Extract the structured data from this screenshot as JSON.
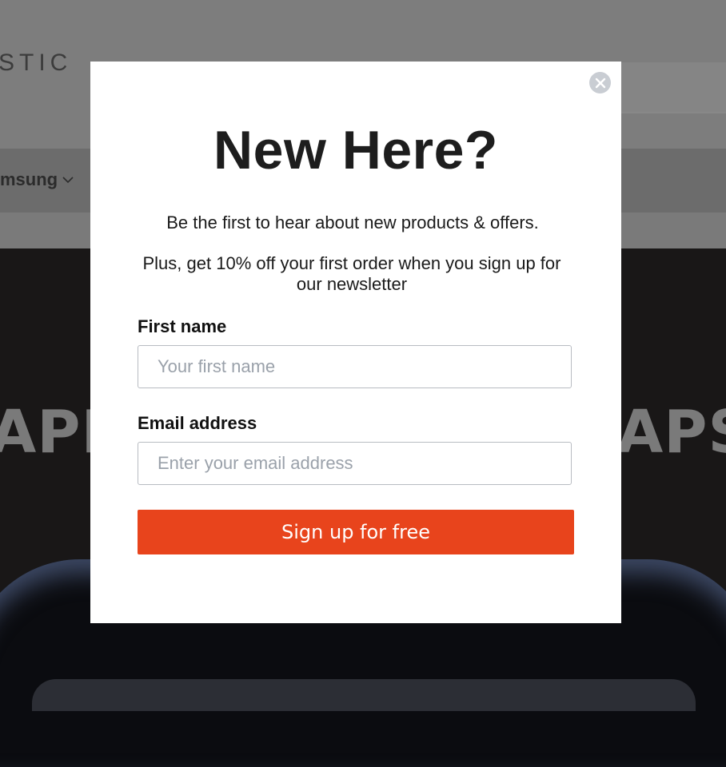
{
  "site": {
    "logo_fragment": "STIC",
    "nav_item": "msung",
    "hero_left_text": "APP",
    "hero_right_text": "APS"
  },
  "modal": {
    "title": "New Here?",
    "subtitle": "Be the first to hear about new products & offers.",
    "offer_text": "Plus, get 10% off your first order when you sign up for our newsletter",
    "first_name_label": "First name",
    "first_name_placeholder": "Your first name",
    "email_label": "Email address",
    "email_placeholder": "Enter your email address",
    "submit_label": "Sign up for free",
    "close_icon": "close-icon"
  },
  "colors": {
    "overlay": "#7b7b7b",
    "submit_bg": "#e8441c",
    "submit_text": "#ffffff",
    "modal_bg": "#ffffff",
    "close_bg": "#c9cdd3"
  }
}
